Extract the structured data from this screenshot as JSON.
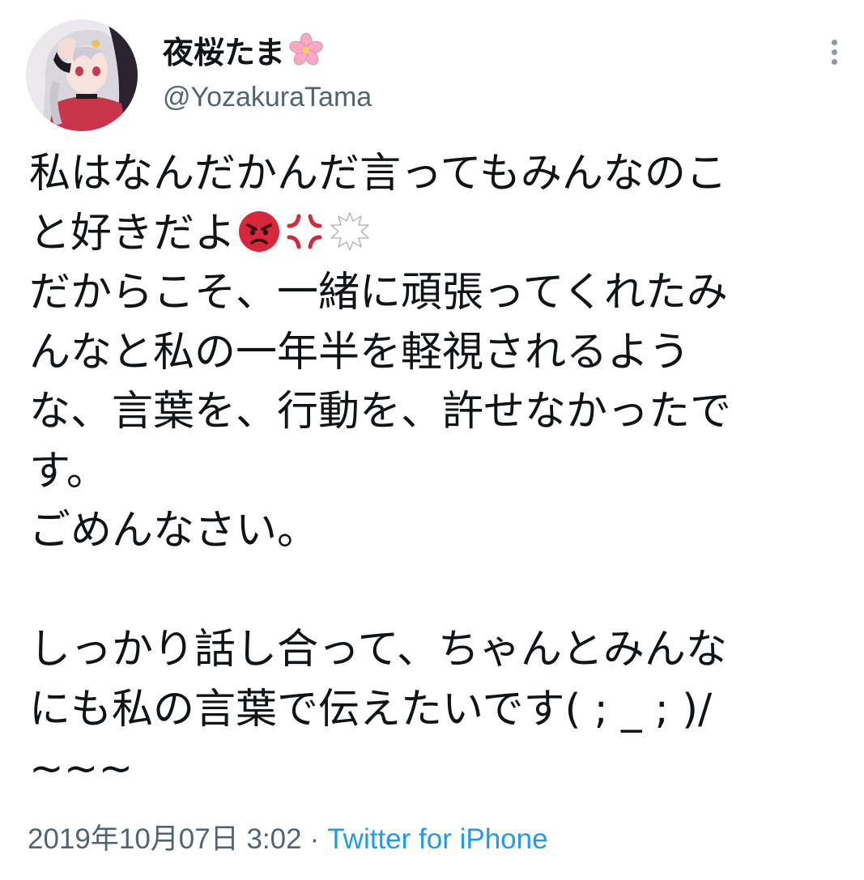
{
  "author": {
    "display_name": "夜桜たま",
    "name_emoji": "cherry-blossom-emoji",
    "handle": "@YozakuraTama"
  },
  "tweet": {
    "lines": [
      "私はなんだかんだ言ってもみんなのこ",
      "と好きだよ",
      "だからこそ、一緒に頑張ってくれたみ",
      "んなと私の一年半を軽視されるよう",
      "な、言葉を、行動を、許せなかったで",
      "す。",
      "ごめんなさい。",
      "",
      "しっかり話し合って、ちゃんとみんな",
      "にも私の言葉で伝えたいです( ; _ ; )/",
      "~~~"
    ],
    "line2_emojis": [
      "pouting-face-emoji",
      "anger-symbol-emoji",
      "right-anger-bubble-emoji"
    ]
  },
  "meta": {
    "timestamp": "2019年10月07日 3:02",
    "separator": "·",
    "source": "Twitter for iPhone"
  },
  "colors": {
    "text": "#0f1419",
    "secondary": "#536471",
    "link": "#1d9bf0"
  }
}
